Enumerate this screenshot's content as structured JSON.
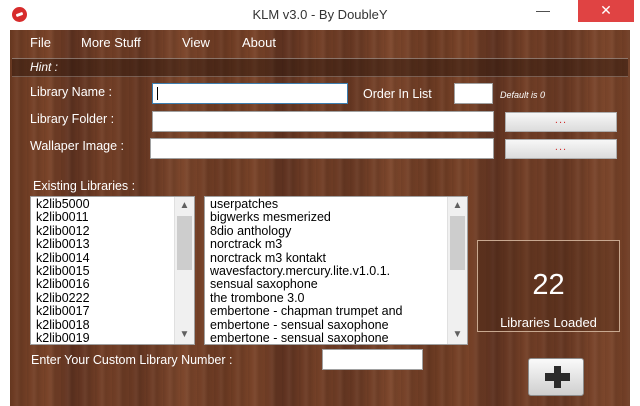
{
  "window": {
    "title": "KLM v3.0 - By DoubleY",
    "minimize": "—",
    "close": "✕"
  },
  "menu": [
    "File",
    "More Stuff",
    "View",
    "About"
  ],
  "hint": {
    "label": "Hint :"
  },
  "form": {
    "library_name_label": "Library Name :",
    "library_name_value": "",
    "order_label": "Order In List",
    "order_value": "",
    "order_default_note": "Default is 0",
    "library_folder_label": "Library Folder :",
    "library_folder_value": "",
    "wallpaper_label": "Wallaper Image :",
    "wallpaper_value": "",
    "browse_label": "...",
    "existing_label": "Existing Libraries :",
    "custom_number_label": "Enter Your Custom Library Number :",
    "custom_number_value": ""
  },
  "libraries_short": [
    "k2lib5000",
    "k2lib0011",
    "k2lib0012",
    "k2lib0013",
    "k2lib0014",
    "k2lib0015",
    "k2lib0016",
    "k2lib0222",
    "k2lib0017",
    "k2lib0018",
    "k2lib0019"
  ],
  "libraries_long": [
    "userpatches",
    "bigwerks mesmerized",
    "8dio anthology",
    "norctrack m3",
    "norctrack m3 kontakt",
    "wavesfactory.mercury.lite.v1.0.1.",
    "sensual saxophone",
    "the trombone 3.0",
    "embertone - chapman trumpet and",
    "embertone - sensual saxophone",
    "embertone - sensual saxophone"
  ],
  "loaded": {
    "count": "22",
    "label": "Libraries Loaded"
  },
  "icons": {
    "app": "app-logo-icon",
    "add": "plus-icon"
  },
  "colors": {
    "close_button": "#e04343",
    "wood": "#6b3a22",
    "browse_text": "#d03030"
  }
}
